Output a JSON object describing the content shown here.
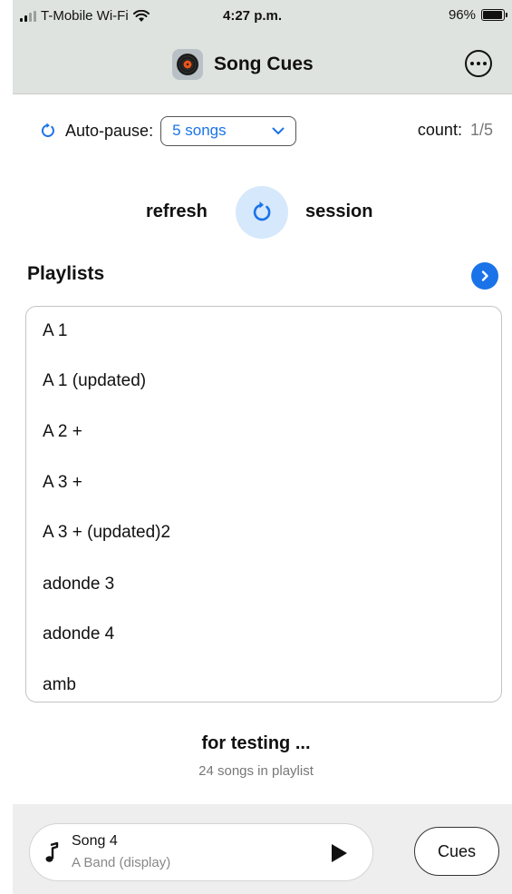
{
  "status_bar": {
    "carrier": "T-Mobile Wi-Fi",
    "time": "4:27 p.m.",
    "battery": "96%",
    "battery_level": 0.96
  },
  "nav": {
    "title": "Song Cues",
    "app_icon": "vinyl-record-icon",
    "more_icon": "ellipsis-circle-icon"
  },
  "autopause": {
    "label": "Auto-pause:",
    "selected": "5 songs",
    "count_label": "count:",
    "count_value": "1/5"
  },
  "refresh": {
    "left_label": "refresh",
    "right_label": "session"
  },
  "playlists": {
    "header": "Playlists",
    "items": [
      "A 1",
      "A 1 (updated)",
      "A 2 +",
      "A 3 +",
      "A 3 + (updated)2",
      "adonde 3",
      "adonde 4",
      "amb"
    ]
  },
  "selection": {
    "name": "for testing ...",
    "song_count": "24 songs in playlist"
  },
  "player": {
    "song_title": "Song 4",
    "song_artist": "A Band (display)",
    "cues_label": "Cues"
  },
  "colors": {
    "accent": "#1a73e8",
    "bar_bg": "#dfe3df",
    "refresh_bg": "#d6e8fb"
  }
}
